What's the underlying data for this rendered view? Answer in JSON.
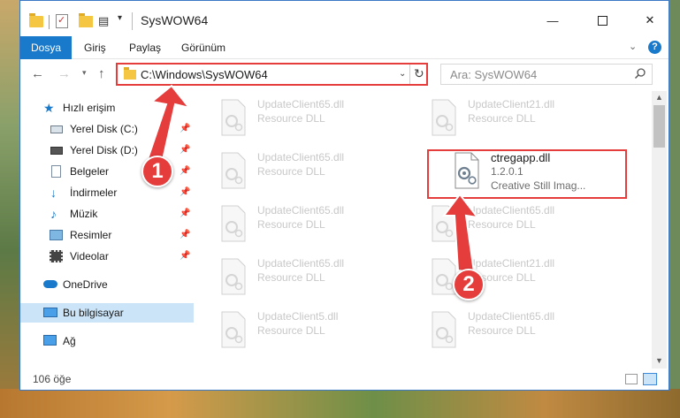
{
  "window": {
    "title": "SysWOW64",
    "minimize_glyph": "—",
    "close_glyph": "✕"
  },
  "ribbon": {
    "tabs": [
      "Dosya",
      "Giriş",
      "Paylaş",
      "Görünüm"
    ],
    "help": "?"
  },
  "nav": {
    "address": "C:\\Windows\\SysWOW64",
    "search_placeholder": "Ara: SysWOW64"
  },
  "sidebar": {
    "quick_access": "Hızlı erişim",
    "items": [
      {
        "label": "Yerel Disk (C:)",
        "icon": "drive-icon",
        "pinned": true
      },
      {
        "label": "Yerel Disk (D:)",
        "icon": "drive-icon",
        "pinned": true
      },
      {
        "label": "Belgeler",
        "icon": "documents-icon",
        "pinned": true
      },
      {
        "label": "İndirmeler",
        "icon": "download-icon",
        "pinned": true
      },
      {
        "label": "Müzik",
        "icon": "music-icon",
        "pinned": true
      },
      {
        "label": "Resimler",
        "icon": "pictures-icon",
        "pinned": true
      },
      {
        "label": "Videolar",
        "icon": "videos-icon",
        "pinned": true
      }
    ],
    "onedrive": "OneDrive",
    "this_pc": "Bu bilgisayar",
    "network": "Ağ"
  },
  "files": {
    "left_column": [
      {
        "name": "UpdateClient65.dll",
        "type": "Resource DLL"
      },
      {
        "name": "UpdateClient65.dll",
        "type": "Resource DLL"
      },
      {
        "name": "UpdateClient65.dll",
        "type": "Resource DLL"
      },
      {
        "name": "UpdateClient65.dll",
        "type": "Resource DLL"
      },
      {
        "name": "UpdateClient5.dll",
        "type": "Resource DLL"
      }
    ],
    "right_column": [
      {
        "name": "UpdateClient21.dll",
        "type": "Resource DLL"
      },
      {
        "name": "UpdateClient65.dll",
        "type": "Resource DLL"
      },
      {
        "name": "UpdateClient21.dll",
        "type": "Resource DLL"
      },
      {
        "name": "UpdateClient65.dll",
        "type": "Resource DLL"
      }
    ],
    "highlighted": {
      "name": "ctregapp.dll",
      "version": "1.2.0.1",
      "description": "Creative Still Imag..."
    }
  },
  "status": {
    "item_count": "106 öğe"
  },
  "annotations": {
    "step1": "1",
    "step2": "2",
    "color": "#e53c3c"
  }
}
